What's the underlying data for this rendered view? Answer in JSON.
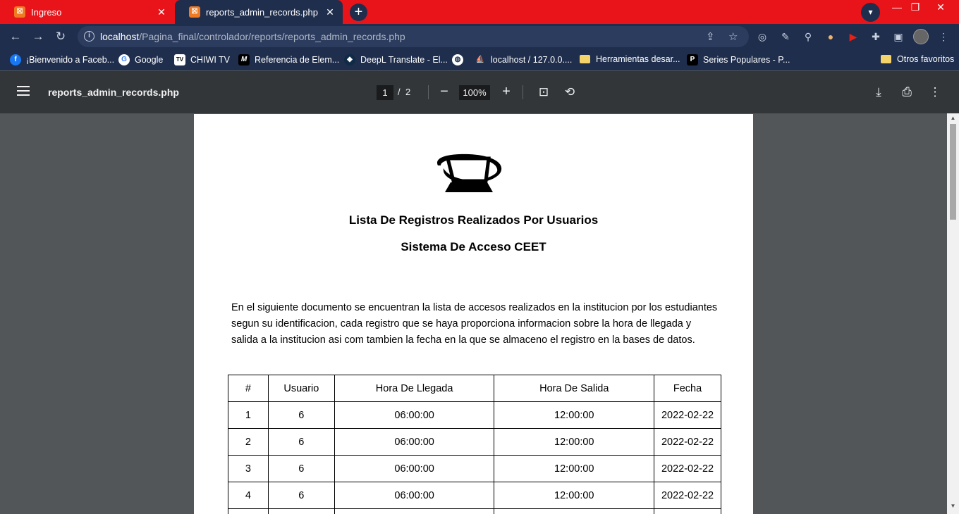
{
  "browser": {
    "tabs": [
      {
        "title": "Ingreso",
        "active": false
      },
      {
        "title": "reports_admin_records.php",
        "active": true
      }
    ],
    "url_host": "localhost",
    "url_path": "/Pagina_final/controlador/reports/reports_admin_records.php",
    "bookmarks": [
      {
        "label": "¡Bienvenido a Faceb...",
        "icon": "facebook-icon",
        "color": "#1877f2"
      },
      {
        "label": "Google",
        "icon": "google-icon",
        "color": "#ffffff"
      },
      {
        "label": "CHIWI TV",
        "icon": "tv-icon",
        "color": "#ffffff"
      },
      {
        "label": "Referencia de Elem...",
        "icon": "mdn-icon",
        "color": "#000000"
      },
      {
        "label": "DeepL Translate - El...",
        "icon": "deepl-icon",
        "color": "#0f2b46"
      },
      {
        "label": "",
        "icon": "globe-icon",
        "color": "#ffffff"
      },
      {
        "label": "localhost / 127.0.0....",
        "icon": "phpmyadmin-icon",
        "color": "#f89c0e"
      },
      {
        "label": "Herramientas desar...",
        "icon": "folder-icon",
        "color": "#f5d36b"
      },
      {
        "label": "Series Populares - P...",
        "icon": "p-icon",
        "color": "#000000"
      }
    ],
    "other_bookmarks": "Otros favoritos"
  },
  "pdf_viewer": {
    "filename": "reports_admin_records.php",
    "current_page": "1",
    "separator": "/",
    "total_pages": "2",
    "zoom": "100%"
  },
  "document": {
    "title": "Lista De Registros Realizados Por Usuarios",
    "subtitle": "Sistema De Acceso CEET",
    "paragraph_lines": [
      "En el siguiente documento se encuentran la lista de accesos realizados en la institucion por los estudiantes",
      "segun su identificacion, cada registro que se haya proporciona informacion sobre la hora de llegada y",
      "salida a la institucion asi com tambien la fecha en la que se almaceno el registro en la bases de datos."
    ],
    "table": {
      "headers": [
        "#",
        "Usuario",
        "Hora De Llegada",
        "Hora De Salida",
        "Fecha"
      ],
      "rows": [
        [
          "1",
          "6",
          "06:00:00",
          "12:00:00",
          "2022-02-22"
        ],
        [
          "2",
          "6",
          "06:00:00",
          "12:00:00",
          "2022-02-22"
        ],
        [
          "3",
          "6",
          "06:00:00",
          "12:00:00",
          "2022-02-22"
        ],
        [
          "4",
          "6",
          "06:00:00",
          "12:00:00",
          "2022-02-22"
        ],
        [
          "",
          "",
          "",
          "",
          ""
        ]
      ]
    }
  }
}
